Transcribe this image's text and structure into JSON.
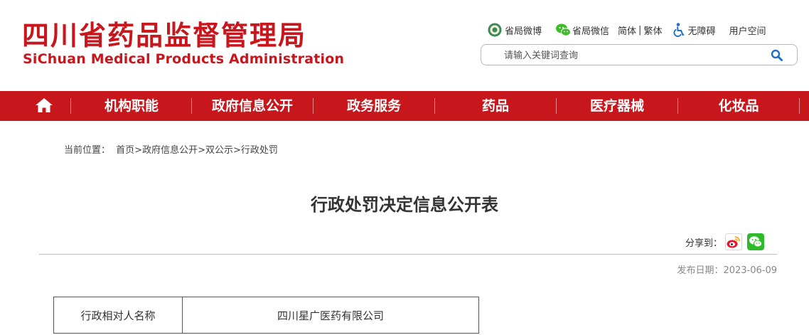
{
  "header": {
    "logo_cn": "四川省药品监督管理局",
    "logo_en": "SiChuan Medical Products Administration"
  },
  "toplinks": {
    "weibo": "省局微博",
    "wechat": "省局微信",
    "simplified": "简体",
    "divider": "|",
    "traditional": "繁体",
    "accessibility": "无障碍",
    "user_space": "用户空间"
  },
  "search": {
    "placeholder": "请输入关键词查询"
  },
  "nav": {
    "items": [
      "机构职能",
      "政府信息公开",
      "政务服务",
      "药品",
      "医疗器械",
      "化妆品"
    ]
  },
  "breadcrumb": {
    "prefix": "当前位置：",
    "home": "首页",
    "sep": ">",
    "level1": "政府信息公开",
    "level2": "双公示",
    "level3": "行政处罚"
  },
  "article": {
    "title": "行政处罚决定信息公开表",
    "share_label": "分享到：",
    "date": "发布日期：2023-06-09"
  },
  "table": {
    "rows": [
      {
        "label": "行政相对人名称",
        "value": "四川星广医药有限公司"
      }
    ]
  },
  "colors": {
    "brand_red": "#c8161d"
  },
  "icons": [
    "emblem-icon",
    "wechat-icon",
    "accessibility-icon",
    "search-icon",
    "home-icon",
    "weibo-share-icon",
    "wechat-share-icon"
  ]
}
